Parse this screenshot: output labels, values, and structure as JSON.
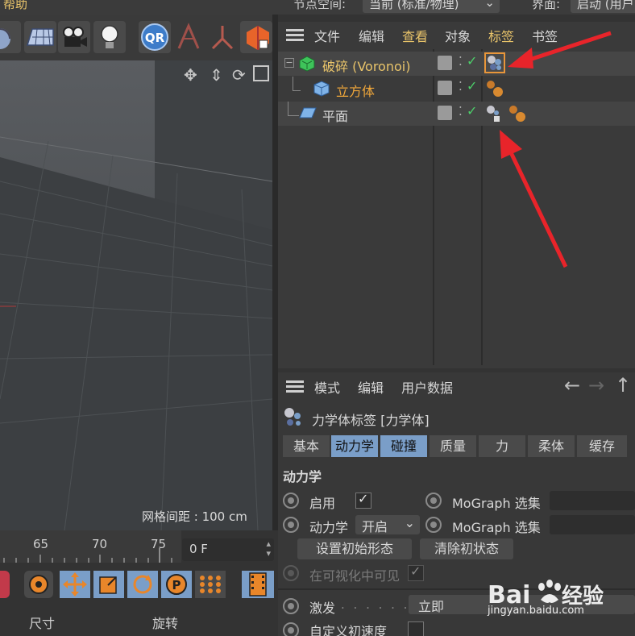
{
  "top_bar": {
    "menu_help": "帮助",
    "coord_space_label": "节点空间:",
    "coord_space_value": "当前 (标准/物理)",
    "layout_label": "界面:",
    "layout_value": "启动 (用户"
  },
  "toolbar": {
    "icons": [
      "sphere-icon",
      "floor-icon",
      "camera-icon",
      "light-icon",
      "qr-icon",
      "character-icon",
      "joint-icon",
      "render-instance-icon"
    ]
  },
  "viewport": {
    "nav_icons": [
      "move-view-icon",
      "zoom-view-icon",
      "rotate-view-icon",
      "maximize-view-icon"
    ],
    "grid_spacing": "网格间距 : 100 cm"
  },
  "object_manager": {
    "menu": [
      "文件",
      "编辑",
      "查看",
      "对象",
      "标签",
      "书签"
    ],
    "highlighted_menu": [
      "查看",
      "标签"
    ],
    "objects": [
      {
        "name": "破碎 (Voronoi)",
        "color": "#e9c46a",
        "icon": "voronoi-fracture-icon",
        "tags": [
          "rigid-body-tag-icon"
        ]
      },
      {
        "name": "立方体",
        "color": "#f0a73a",
        "icon": "cube-icon",
        "tags": [
          "material-tag-icon"
        ]
      },
      {
        "name": "平面",
        "color": "#d8d8d8",
        "icon": "plane-icon",
        "tags": [
          "collider-body-tag-icon",
          "material-tag-icon"
        ]
      }
    ]
  },
  "attribute_manager": {
    "menu": [
      "模式",
      "编辑",
      "用户数据"
    ],
    "title": "力学体标签 [力学体]",
    "tabs": [
      "基本",
      "动力学",
      "碰撞",
      "质量",
      "力",
      "柔体",
      "缓存"
    ],
    "active_tabs": [
      "动力学",
      "碰撞"
    ],
    "section_title": "动力学",
    "fields": {
      "enabled_label": "启用",
      "enabled_checked": true,
      "mograph_selection_label_1": "MoGraph 选集",
      "dynamics_label": "动力学",
      "dynamics_value": "开启",
      "mograph_selection_label_2": "MoGraph 选集",
      "set_initial_state": "设置初始形态",
      "clear_initial_state": "清除初状态",
      "visible_in_viewport_label": "在可视化中可见",
      "visible_in_viewport_checked": true,
      "trigger_label": "激发",
      "trigger_value": "立即",
      "custom_initial_velocity_label": "自定义初速度",
      "custom_initial_velocity_checked": false
    }
  },
  "timeline": {
    "ticks": [
      "65",
      "70",
      "75"
    ],
    "current_frame": "0 F",
    "labels": [
      "尺寸",
      "旋转"
    ],
    "tool_icons": [
      "record-icon",
      "autokey-icon",
      "move-key-icon",
      "scale-key-icon",
      "rotate-key-icon",
      "param-key-icon",
      "pla-key-icon",
      "film-icon"
    ]
  },
  "watermark": {
    "brand": "Bai du 经验",
    "url": "jingyan.baidu.com"
  },
  "colors": {
    "accent_yellow": "#e9c46a",
    "accent_orange": "#f0a73a",
    "tab_active": "#7a9ec8",
    "check_green": "#4ccf6a",
    "arrow_red": "#e8242a"
  }
}
